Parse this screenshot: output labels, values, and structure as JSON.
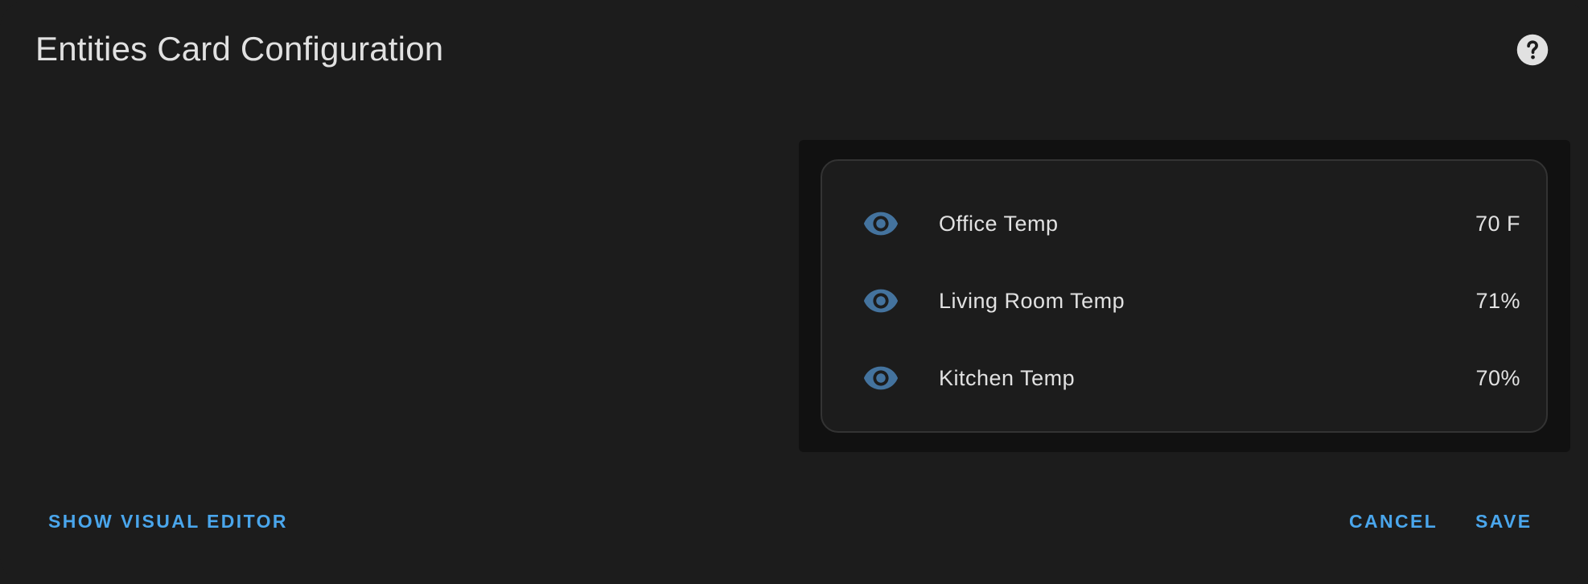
{
  "dialog": {
    "title": "Entities Card Configuration",
    "help_icon": "help-circle-icon"
  },
  "card": {
    "entities": [
      {
        "icon": "eye-icon",
        "name": "Office Temp",
        "state": "70 F"
      },
      {
        "icon": "eye-icon",
        "name": "Living Room Temp",
        "state": "71%"
      },
      {
        "icon": "eye-icon",
        "name": "Kitchen Temp",
        "state": "70%"
      }
    ]
  },
  "actions": {
    "show_visual_editor": "SHOW VISUAL EDITOR",
    "cancel": "CANCEL",
    "save": "SAVE"
  },
  "colors": {
    "background": "#1c1c1c",
    "preview_background": "#111111",
    "accent": "#4aa6ec",
    "icon": "#44739e",
    "text": "#e1e1e1"
  }
}
